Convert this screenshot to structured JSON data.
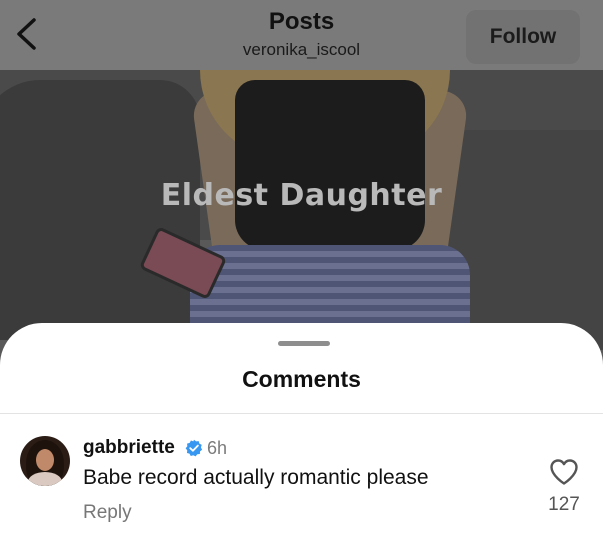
{
  "header": {
    "title": "Posts",
    "username": "veronika_iscool",
    "follow_label": "Follow"
  },
  "post": {
    "overlay_caption": "Eldest Daughter"
  },
  "comments_sheet": {
    "title": "Comments",
    "comments": [
      {
        "username": "gabbriette",
        "verified": true,
        "time": "6h",
        "text": "Babe record actually romantic please",
        "reply_label": "Reply",
        "likes": "127"
      }
    ]
  },
  "colors": {
    "verified_badge": "#3897f0",
    "sheet_background": "#ffffff",
    "dim_overlay": "#6f6f6f"
  },
  "icons": {
    "back": "chevron-left-icon",
    "verified": "verified-badge-icon",
    "like": "heart-outline-icon"
  }
}
